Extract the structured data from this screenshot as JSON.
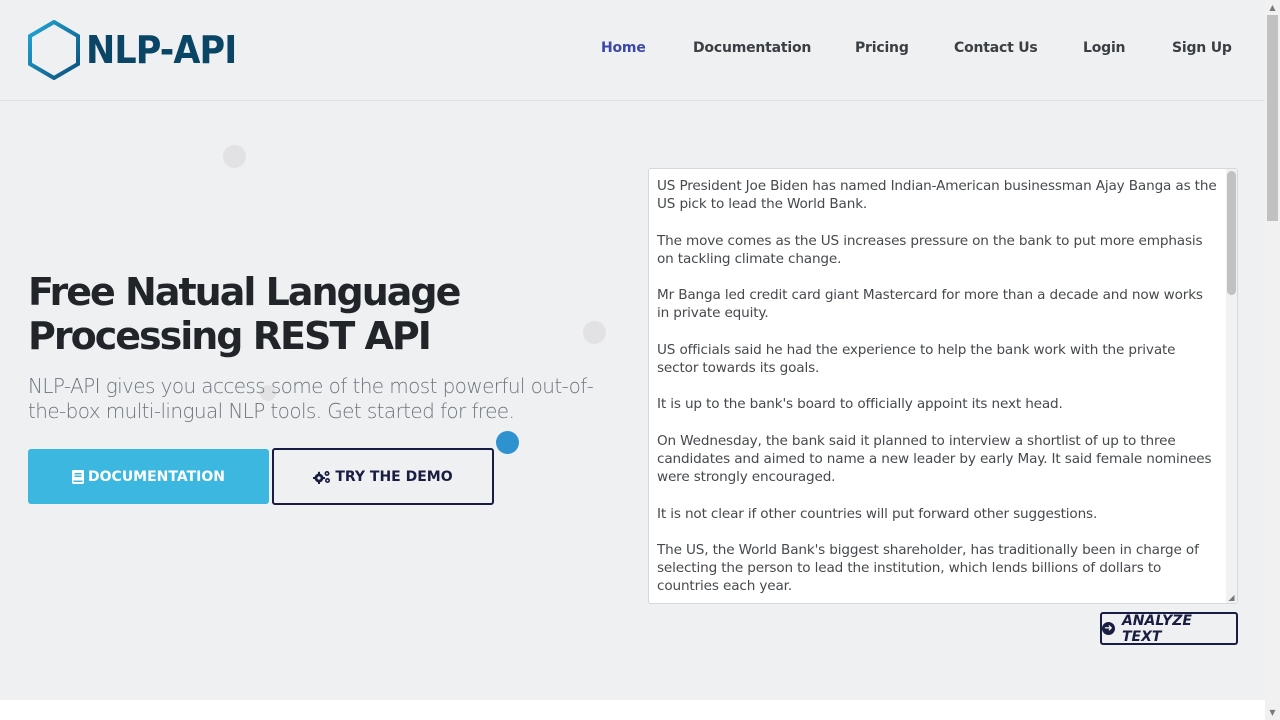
{
  "brand": {
    "name": "NLP-API",
    "logo_color": "#0b4566",
    "logo_accent": "#1b9fd1"
  },
  "nav": {
    "items": [
      {
        "label": "Home",
        "active": true
      },
      {
        "label": "Documentation",
        "active": false
      },
      {
        "label": "Pricing",
        "active": false
      },
      {
        "label": "Contact Us",
        "active": false
      },
      {
        "label": "Login",
        "active": false
      },
      {
        "label": "Sign Up",
        "active": false
      }
    ]
  },
  "hero": {
    "title_line1": "Free Natual Language",
    "title_line2": "Processing REST API",
    "subtitle": "NLP-API gives you access some of the most powerful out-of-the-box multi-lingual NLP tools. Get started for free.",
    "doc_button": {
      "label": "DOCUMENTATION",
      "icon": "book-icon"
    },
    "demo_button": {
      "label": "TRY THE DEMO",
      "icon": "cogs-icon"
    }
  },
  "demo": {
    "text": "US President Joe Biden has named Indian-American businessman Ajay Banga as the US pick to lead the World Bank.\n\nThe move comes as the US increases pressure on the bank to put more emphasis on tackling climate change.\n\nMr Banga led credit card giant Mastercard for more than a decade and now works in private equity.\n\nUS officials said he had the experience to help the bank work with the private sector towards its goals.\n\nIt is up to the bank's board to officially appoint its next head.\n\nOn Wednesday, the bank said it planned to interview a shortlist of up to three candidates and aimed to name a new leader by early May. It said female nominees were strongly encouraged.\n\nIt is not clear if other countries will put forward other suggestions.\n\nThe US, the World Bank's biggest shareholder, has traditionally been in charge of selecting the person to lead the institution, which lends billions of dollars to countries each year.",
    "analyze_button": {
      "label": "ANALYZE TEXT",
      "icon": "arrow-circle-right-icon"
    }
  },
  "colors": {
    "background": "#eff0f2",
    "nav_active": "#3c48a8",
    "primary_button": "#3cb8e0",
    "dark_outline": "#1a1d42"
  }
}
